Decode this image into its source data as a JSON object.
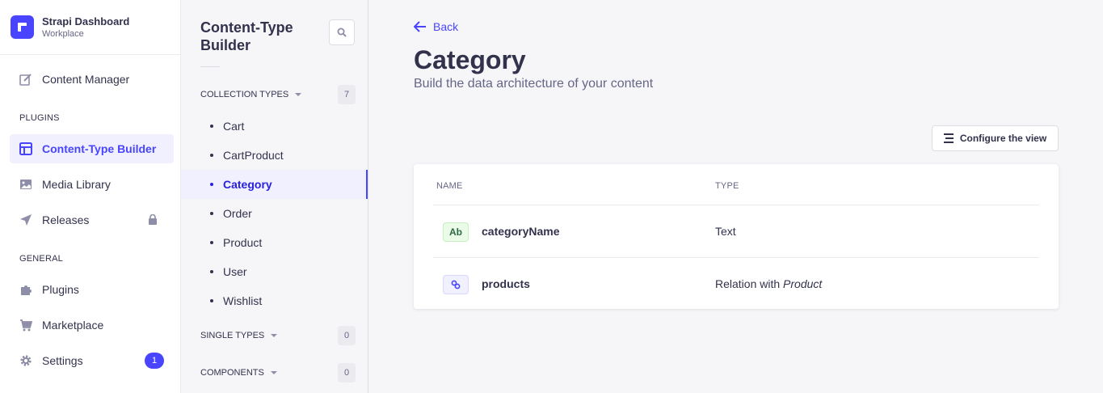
{
  "brand": {
    "title": "Strapi Dashboard",
    "subtitle": "Workplace"
  },
  "main_nav": {
    "content_manager": "Content Manager",
    "plugins_section": "PLUGINS",
    "content_type_builder": "Content-Type Builder",
    "media_library": "Media Library",
    "releases": "Releases",
    "general_section": "GENERAL",
    "plugins": "Plugins",
    "marketplace": "Marketplace",
    "settings": "Settings",
    "settings_badge": "1"
  },
  "sub_nav": {
    "title": "Content-Type Builder",
    "collection_types": {
      "label": "COLLECTION TYPES",
      "count": "7"
    },
    "items": [
      "Cart",
      "CartProduct",
      "Category",
      "Order",
      "Product",
      "User",
      "Wishlist"
    ],
    "active_item": "Category",
    "single_types": {
      "label": "SINGLE TYPES",
      "count": "0"
    },
    "components": {
      "label": "COMPONENTS",
      "count": "0"
    }
  },
  "header": {
    "back": "Back",
    "title": "Category",
    "subtitle": "Build the data architecture of your content",
    "configure_button": "Configure the view"
  },
  "table": {
    "columns": [
      "NAME",
      "TYPE"
    ],
    "rows": [
      {
        "icon": "Ab",
        "name": "categoryName",
        "type": "Text",
        "type_italic": ""
      },
      {
        "icon": "relation-icon",
        "name": "products",
        "type": "Relation with ",
        "type_italic": "Product"
      }
    ]
  },
  "colors": {
    "accent": "#4945ff",
    "active_bg": "#f0f0ff"
  }
}
